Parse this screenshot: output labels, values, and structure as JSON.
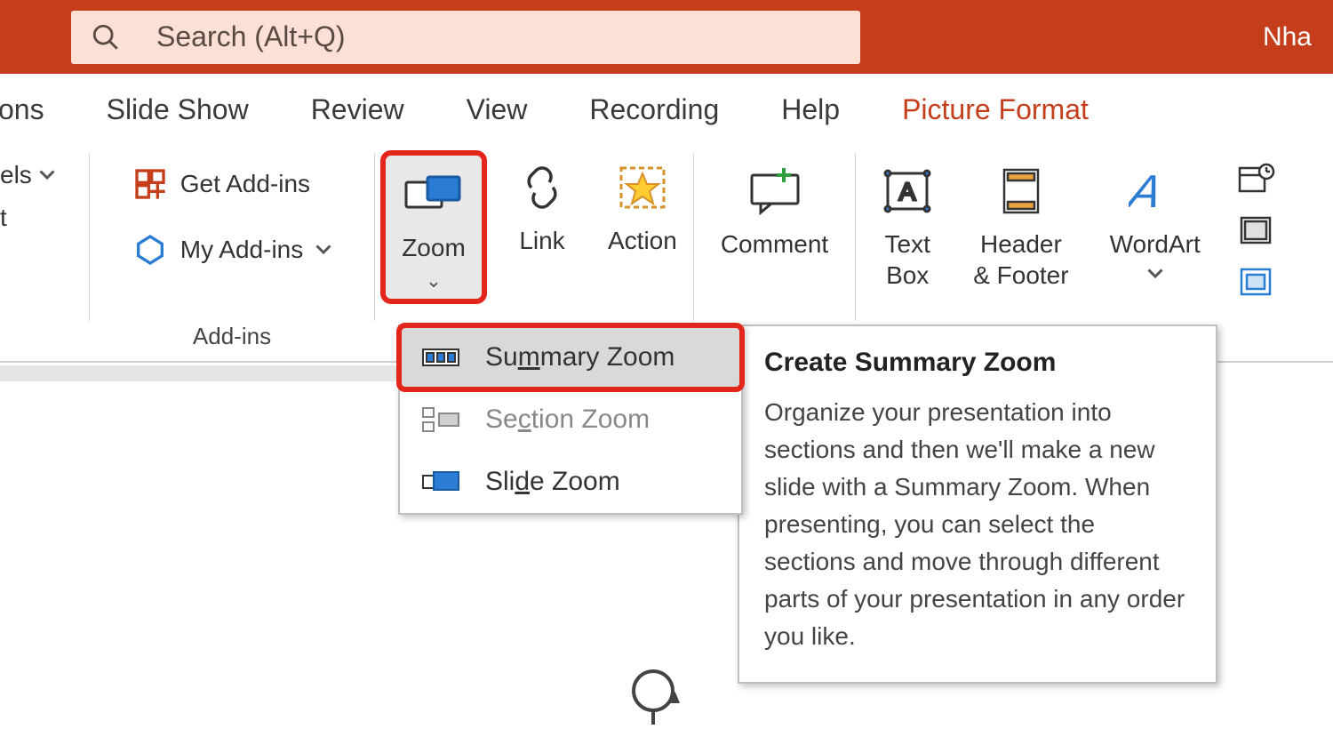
{
  "search": {
    "placeholder": "Search (Alt+Q)"
  },
  "title_right": "Nha",
  "tabs": {
    "partial": "tions",
    "slide_show": "Slide Show",
    "review": "Review",
    "view": "View",
    "recording": "Recording",
    "help": "Help",
    "picture_format": "Picture Format"
  },
  "left_partial": {
    "line1": "els",
    "line2": "t"
  },
  "addins": {
    "get": "Get Add-ins",
    "my": "My Add-ins",
    "group_label": "Add-ins"
  },
  "ribbon": {
    "zoom": "Zoom",
    "link": "Link",
    "action": "Action",
    "comment": "Comment",
    "text_box": "Text\nBox",
    "header_footer": "Header\n& Footer",
    "wordart": "WordArt"
  },
  "zoom_menu": {
    "summary": "Summary Zoom",
    "section": "Section Zoom",
    "slide": "Slide Zoom"
  },
  "tooltip": {
    "title": "Create Summary Zoom",
    "body": "Organize your presentation into sections and then we'll make a new slide with a Summary Zoom. When presenting, you can select the sections and move through different parts of your presentation in any order you like."
  }
}
